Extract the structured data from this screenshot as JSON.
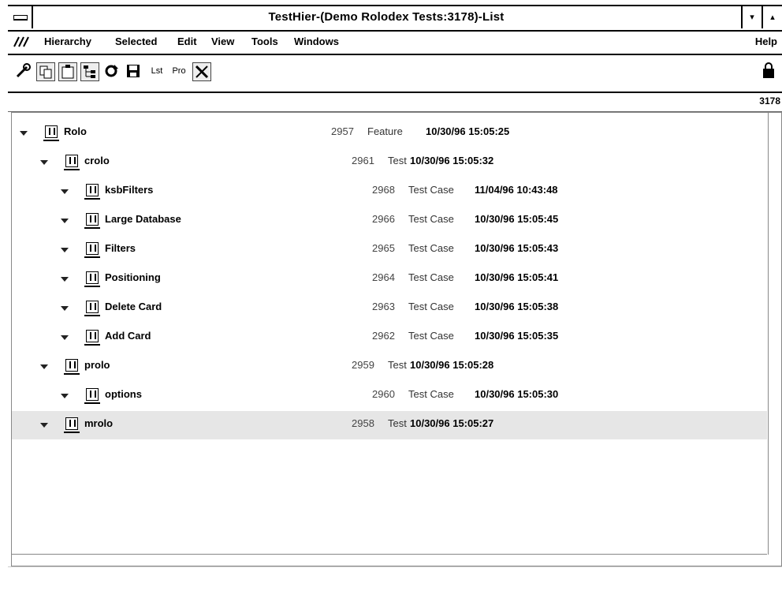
{
  "window": {
    "title": "TestHier-(Demo Rolodex Tests:3178)-List",
    "sysmenu_label": "",
    "minimize_label": "▾",
    "maximize_label": "▴"
  },
  "menu": {
    "items": [
      "Hierarchy",
      "Selected",
      "Edit",
      "View",
      "Tools",
      "Windows"
    ],
    "help": "Help"
  },
  "toolbar": {
    "list_label": "Lst",
    "pro_label": "Pro"
  },
  "status": {
    "number": "3178"
  },
  "rows": [
    {
      "name": "Rolo",
      "id": "2957",
      "type": "Feature",
      "date": "10/30/96 15:05:25"
    },
    {
      "name": "crolo",
      "id": "2961",
      "type": "Test",
      "date": "10/30/96 15:05:32"
    },
    {
      "name": "ksbFilters",
      "id": "2968",
      "type": "Test Case",
      "date": "11/04/96 10:43:48"
    },
    {
      "name": "Large Database",
      "id": "2966",
      "type": "Test Case",
      "date": "10/30/96 15:05:45"
    },
    {
      "name": "Filters",
      "id": "2965",
      "type": "Test Case",
      "date": "10/30/96 15:05:43"
    },
    {
      "name": "Positioning",
      "id": "2964",
      "type": "Test Case",
      "date": "10/30/96 15:05:41"
    },
    {
      "name": "Delete Card",
      "id": "2963",
      "type": "Test Case",
      "date": "10/30/96 15:05:38"
    },
    {
      "name": "Add Card",
      "id": "2962",
      "type": "Test Case",
      "date": "10/30/96 15:05:35"
    },
    {
      "name": "prolo",
      "id": "2959",
      "type": "Test",
      "date": "10/30/96 15:05:28"
    },
    {
      "name": "options",
      "id": "2960",
      "type": "Test Case",
      "date": "10/30/96 15:05:30"
    },
    {
      "name": "mrolo",
      "id": "2958",
      "type": "Test",
      "date": "10/30/96 15:05:27"
    }
  ]
}
